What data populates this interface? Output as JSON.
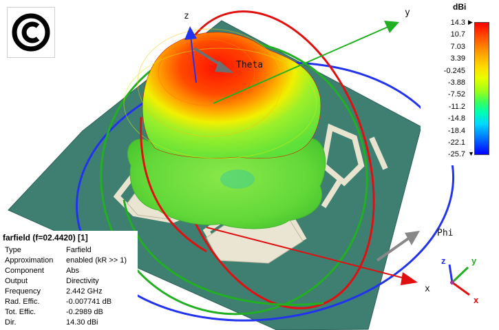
{
  "scene": {
    "axis_labels": {
      "x": "x",
      "y": "y",
      "z": "z",
      "theta": "Theta",
      "phi": "Phi"
    },
    "colors": {
      "background": "#ffffff",
      "substrate": "#3e7f72",
      "patch_outline": "#e8e4cf",
      "pattern_peak": "#ff1a00",
      "pattern_base": "#7de03a",
      "ring_red": "#e01010",
      "ring_green": "#22b022",
      "ring_blue": "#2233ee",
      "theta_arrow": "#6f6f6f",
      "phi_arrow": "#888888"
    }
  },
  "orientation_triad": {
    "x": "x",
    "y": "y",
    "z": "z"
  },
  "logo": {
    "icon": "copyright-c-logo"
  },
  "colorbar": {
    "unit": "dBi",
    "ticks": [
      "14.3",
      "10.7",
      "7.03",
      "3.39",
      "-0.245",
      "-3.88",
      "-7.52",
      "-11.2",
      "-14.8",
      "-18.4",
      "-22.1",
      "-25.7"
    ],
    "max": 14.3,
    "min": -25.7
  },
  "info": {
    "title": "farfield (f=02.4420) [1]",
    "rows": [
      {
        "label": "Type",
        "value": "Farfield"
      },
      {
        "label": "Approximation",
        "value": "enabled (kR >> 1)"
      },
      {
        "label": "Component",
        "value": "Abs"
      },
      {
        "label": "Output",
        "value": "Directivity"
      },
      {
        "label": "Frequency",
        "value": "2.442 GHz"
      },
      {
        "label": "Rad. Effic.",
        "value": "-0.007741 dB"
      },
      {
        "label": "Tot. Effic.",
        "value": "-0.2989 dB"
      },
      {
        "label": "Dir.",
        "value": "14.30 dBi"
      }
    ]
  }
}
